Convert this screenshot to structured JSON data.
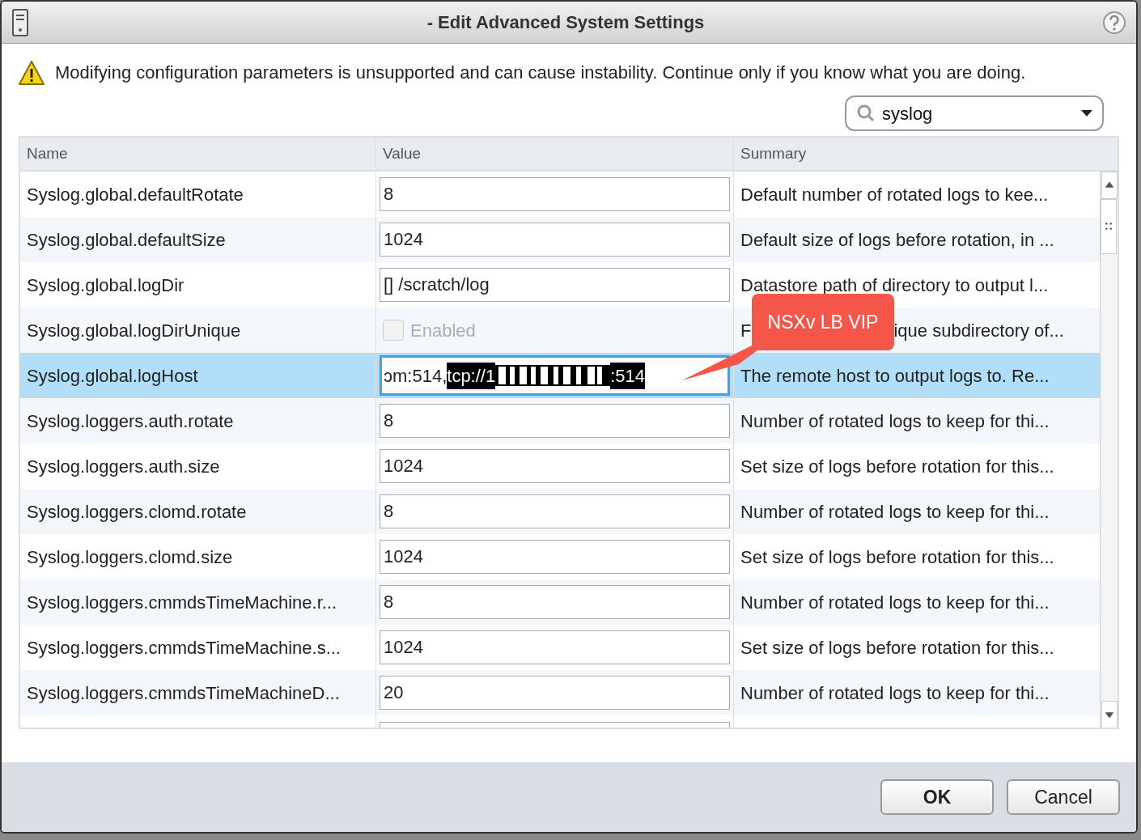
{
  "window": {
    "title": "- Edit Advanced System Settings"
  },
  "warning": "Modifying configuration parameters is unsupported and can cause instability. Continue only if you know what you are doing.",
  "filter": {
    "value": "syslog"
  },
  "table": {
    "columns": [
      "Name",
      "Value",
      "Summary"
    ],
    "rows": [
      {
        "name": "Syslog.global.defaultRotate",
        "kind": "text",
        "value": "8",
        "summary": [
          "Default number of rotated logs to kee..."
        ],
        "selected": false
      },
      {
        "name": "Syslog.global.defaultSize",
        "kind": "text",
        "value": "1024",
        "summary": [
          "Default size of logs before rotation, in ..."
        ],
        "selected": false
      },
      {
        "name": "Syslog.global.logDir",
        "kind": "text",
        "value": "[] /scratch/log",
        "summary": [
          "Datastore path of directory to output l..."
        ],
        "selected": false
      },
      {
        "name": "Syslog.global.logDirUnique",
        "kind": "checkbox",
        "label": "Enabled",
        "checked": false,
        "disabled": true,
        "summary": [
          "F",
          "ique subdirectory of..."
        ],
        "selected": false
      },
      {
        "name": "Syslog.global.logHost",
        "kind": "editing",
        "value_parts": [
          {
            "kind": "text",
            "text": "ɔm:514,",
            "selected": false
          },
          {
            "kind": "text",
            "text": "tcp://1",
            "selected": true
          },
          {
            "kind": "redacted"
          },
          {
            "kind": "text",
            "text": ":514",
            "selected": true
          }
        ],
        "summary": [
          "The remote host to output logs to. Re..."
        ],
        "selected": true
      },
      {
        "name": "Syslog.loggers.auth.rotate",
        "kind": "text",
        "value": "8",
        "summary": [
          "Number of rotated logs to keep for thi..."
        ],
        "selected": false
      },
      {
        "name": "Syslog.loggers.auth.size",
        "kind": "text",
        "value": "1024",
        "summary": [
          "Set size of logs before rotation for this..."
        ],
        "selected": false
      },
      {
        "name": "Syslog.loggers.clomd.rotate",
        "kind": "text",
        "value": "8",
        "summary": [
          "Number of rotated logs to keep for thi..."
        ],
        "selected": false
      },
      {
        "name": "Syslog.loggers.clomd.size",
        "kind": "text",
        "value": "1024",
        "summary": [
          "Set size of logs before rotation for this..."
        ],
        "selected": false
      },
      {
        "name": "Syslog.loggers.cmmdsTimeMachine.r...",
        "kind": "text",
        "value": "8",
        "summary": [
          "Number of rotated logs to keep for thi..."
        ],
        "selected": false
      },
      {
        "name": "Syslog.loggers.cmmdsTimeMachine.s...",
        "kind": "text",
        "value": "1024",
        "summary": [
          "Set size of logs before rotation for this..."
        ],
        "selected": false
      },
      {
        "name": "Syslog.loggers.cmmdsTimeMachineD...",
        "kind": "text",
        "value": "20",
        "summary": [
          "Number of rotated logs to keep for thi..."
        ],
        "selected": false
      }
    ]
  },
  "callout": "NSXv LB VIP",
  "buttons": [
    {
      "label": "OK",
      "primary": true
    },
    {
      "label": "Cancel",
      "primary": false
    }
  ]
}
